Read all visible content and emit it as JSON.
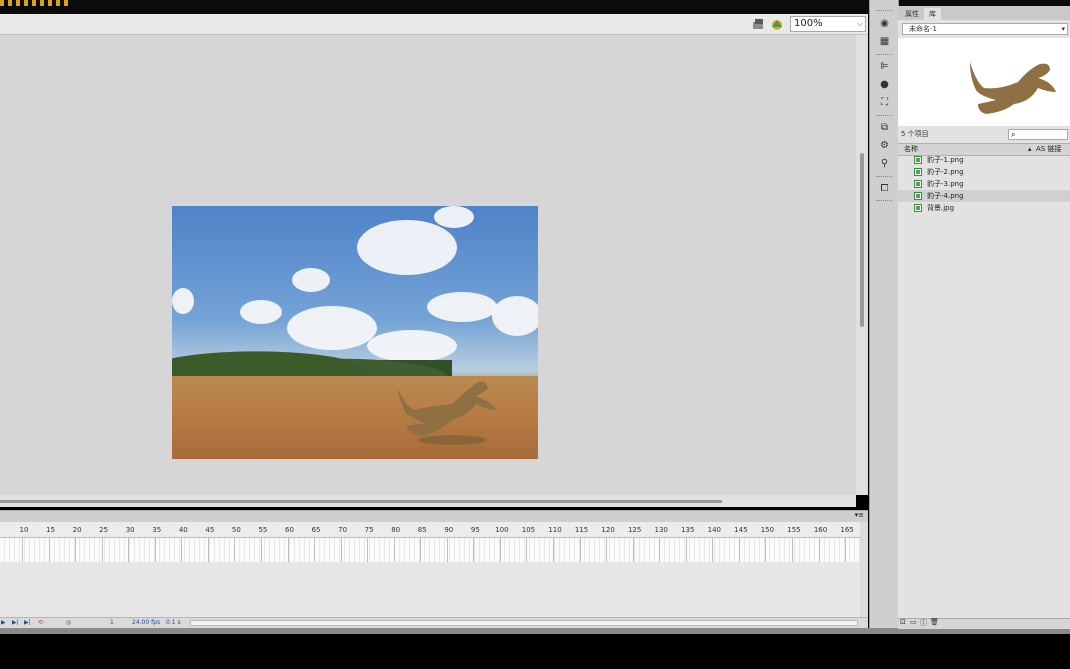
{
  "stage": {
    "zoom_value": "100%",
    "edit_symbol_icon": "edit-symbols-icon",
    "edit_scene_icon": "edit-scene-icon"
  },
  "timeline": {
    "ruler_ticks": [
      "10",
      "15",
      "20",
      "25",
      "30",
      "35",
      "40",
      "45",
      "50",
      "55",
      "60",
      "65",
      "70",
      "75",
      "80",
      "85",
      "90",
      "95",
      "100",
      "105",
      "110",
      "115",
      "120",
      "125",
      "130",
      "135",
      "140",
      "145",
      "150",
      "155",
      "160",
      "165"
    ],
    "current_frame": "1",
    "frame_rate": "24.00 fps",
    "elapsed_time": "0.1 s"
  },
  "library": {
    "tabs": [
      "属性",
      "库"
    ],
    "active_tab": "库",
    "document": "未命名-1",
    "item_count": "5 个项目",
    "search_placeholder": "",
    "column_name": "名称",
    "column_linkage": "AS 链接",
    "items": [
      {
        "name": "豹子-1.png"
      },
      {
        "name": "豹子-2.png"
      },
      {
        "name": "豹子-3.png"
      },
      {
        "name": "豹子-4.png",
        "selected": true
      },
      {
        "name": "背景.jpg"
      }
    ]
  },
  "colors": {
    "stage_background": "#d6d6d6",
    "panel_background": "#e2e2e2",
    "selection": "#d0d0d0",
    "bitmap_icon": "#4fa64f"
  }
}
